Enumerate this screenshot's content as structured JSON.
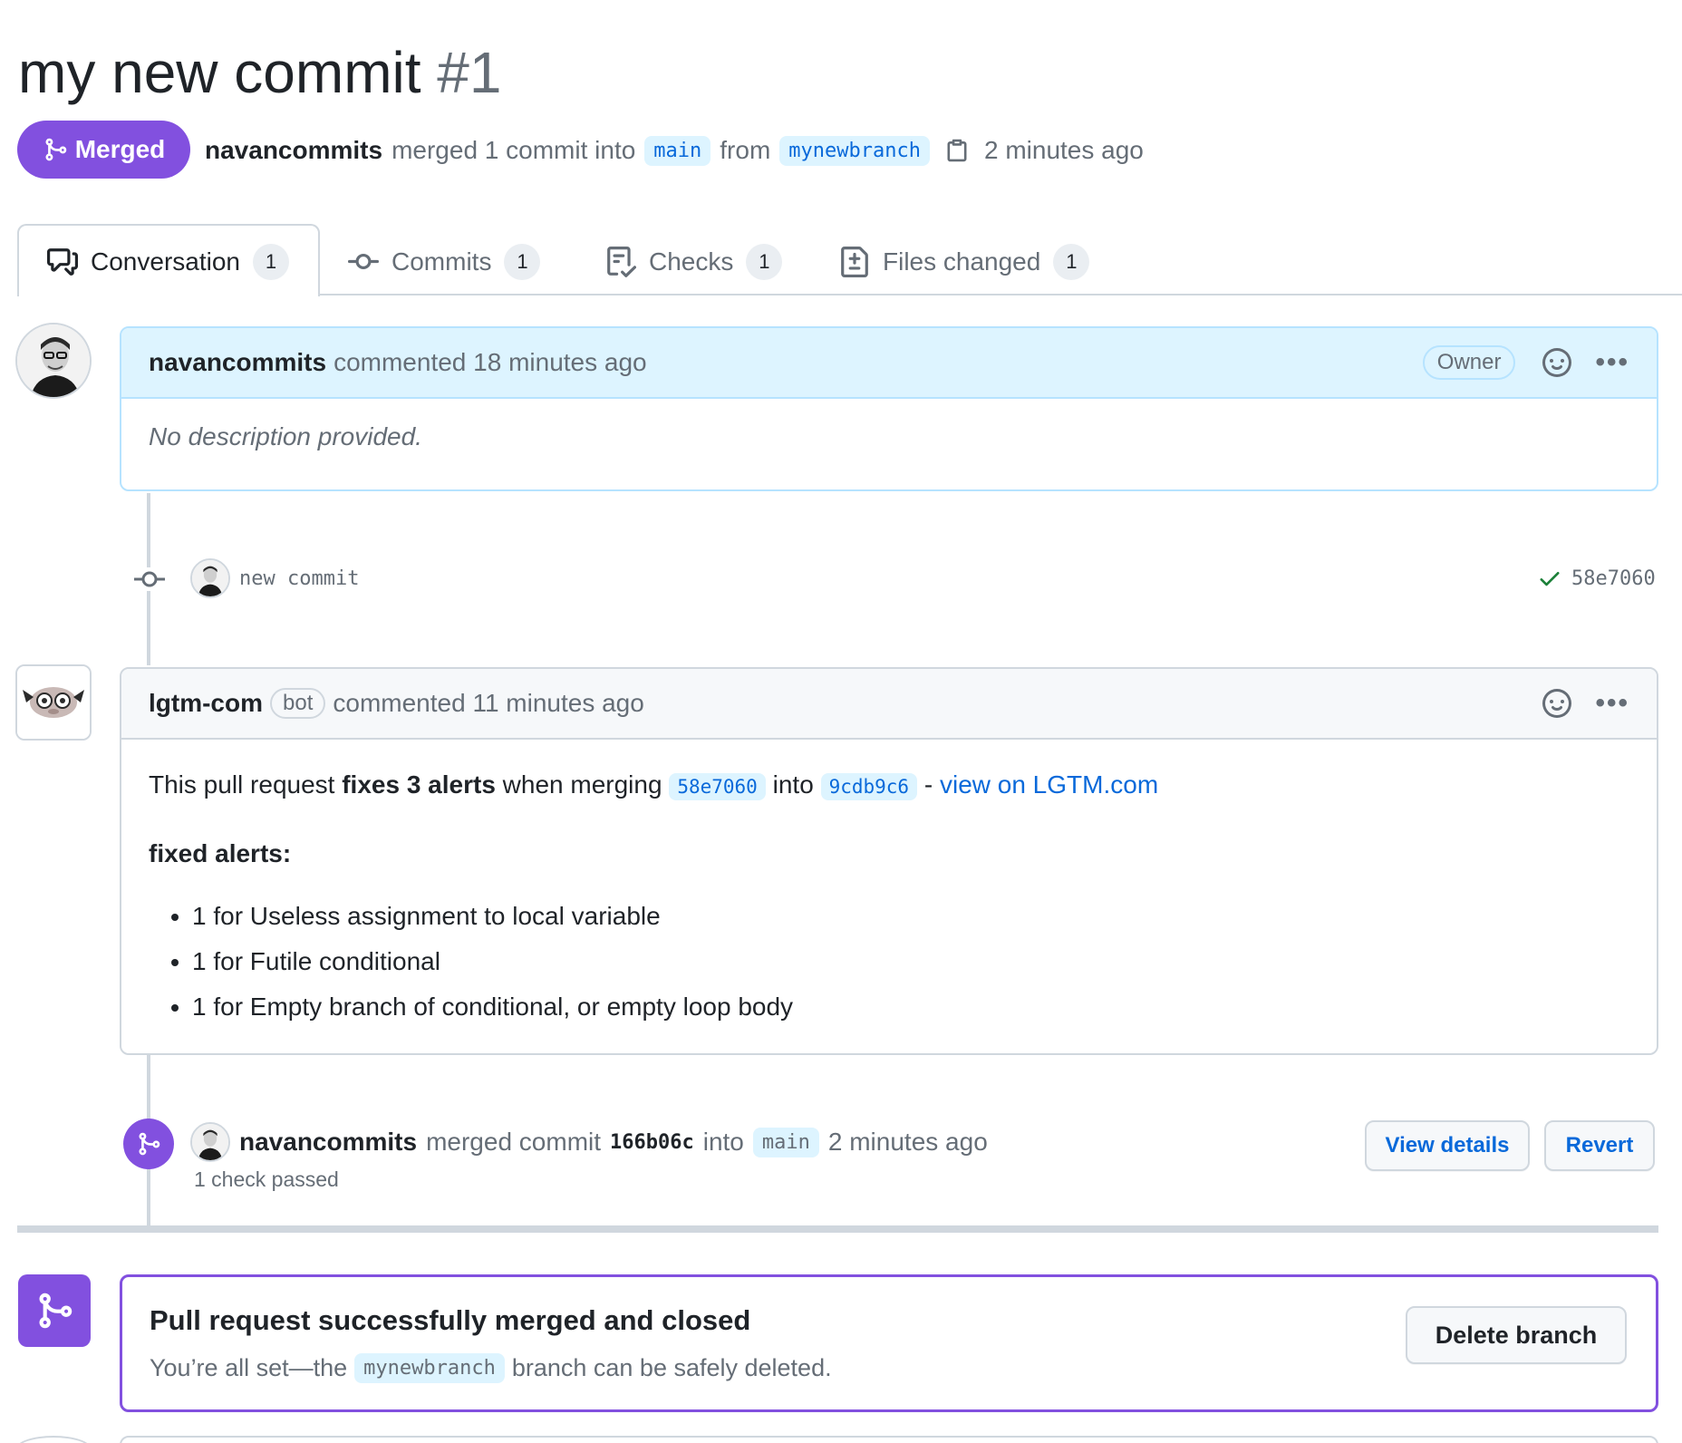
{
  "pr": {
    "title": "my new commit",
    "number": "#1",
    "state": "Merged",
    "author": "navancommits",
    "merge_text": "merged 1 commit into",
    "base_branch": "main",
    "from_text": "from",
    "head_branch": "mynewbranch",
    "time": "2 minutes ago"
  },
  "tabs": [
    {
      "label": "Conversation",
      "count": "1",
      "icon": "comment-discussion-icon",
      "active": true
    },
    {
      "label": "Commits",
      "count": "1",
      "icon": "git-commit-icon",
      "active": false
    },
    {
      "label": "Checks",
      "count": "1",
      "icon": "checklist-icon",
      "active": false
    },
    {
      "label": "Files changed",
      "count": "1",
      "icon": "file-diff-icon",
      "active": false
    }
  ],
  "comment1": {
    "author": "navancommits",
    "action": "commented 18 minutes ago",
    "role": "Owner",
    "body": "No description provided."
  },
  "commit": {
    "message": "new commit",
    "sha": "58e7060",
    "status": "success"
  },
  "comment2": {
    "author": "lgtm-com",
    "badge": "bot",
    "action": "commented 11 minutes ago",
    "p1_a": "This pull request",
    "p1_bold": "fixes 3 alerts",
    "p1_b": "when merging",
    "sha_from": "58e7060",
    "into": "into",
    "sha_to": "9cdb9c6",
    "dash": "-",
    "link": "view on LGTM.com",
    "heading": "fixed alerts:",
    "alerts": [
      "1 for Useless assignment to local variable",
      "1 for Futile conditional",
      "1 for Empty branch of conditional, or empty loop body"
    ]
  },
  "merge_event": {
    "author": "navancommits",
    "text": "merged commit",
    "sha": "166b06c",
    "into": "into",
    "branch": "main",
    "time": "2 minutes ago",
    "checks": "1 check passed",
    "view_details": "View details",
    "revert": "Revert"
  },
  "merged_box": {
    "title": "Pull request successfully merged and closed",
    "desc_a": "You’re all set—the",
    "branch": "mynewbranch",
    "desc_b": "branch can be safely deleted.",
    "delete_button": "Delete branch"
  },
  "colors": {
    "merged": "#8250df",
    "link": "#0969da",
    "owner_header": "#ddf4ff",
    "success": "#1a7f37"
  }
}
